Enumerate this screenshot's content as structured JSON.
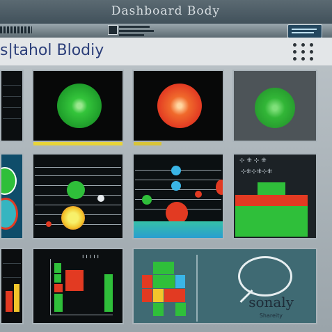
{
  "window": {
    "title": "Dashboard Body"
  },
  "header": {
    "title": "s|tahol Blodiy"
  },
  "panels": {
    "bottom_right_text": "sonaly",
    "bottom_right_sub": "Shareity"
  },
  "colors": {
    "green": "#2fbf3a",
    "red": "#e23a22",
    "yellow": "#f2d22b",
    "blue": "#3ab5e6"
  }
}
